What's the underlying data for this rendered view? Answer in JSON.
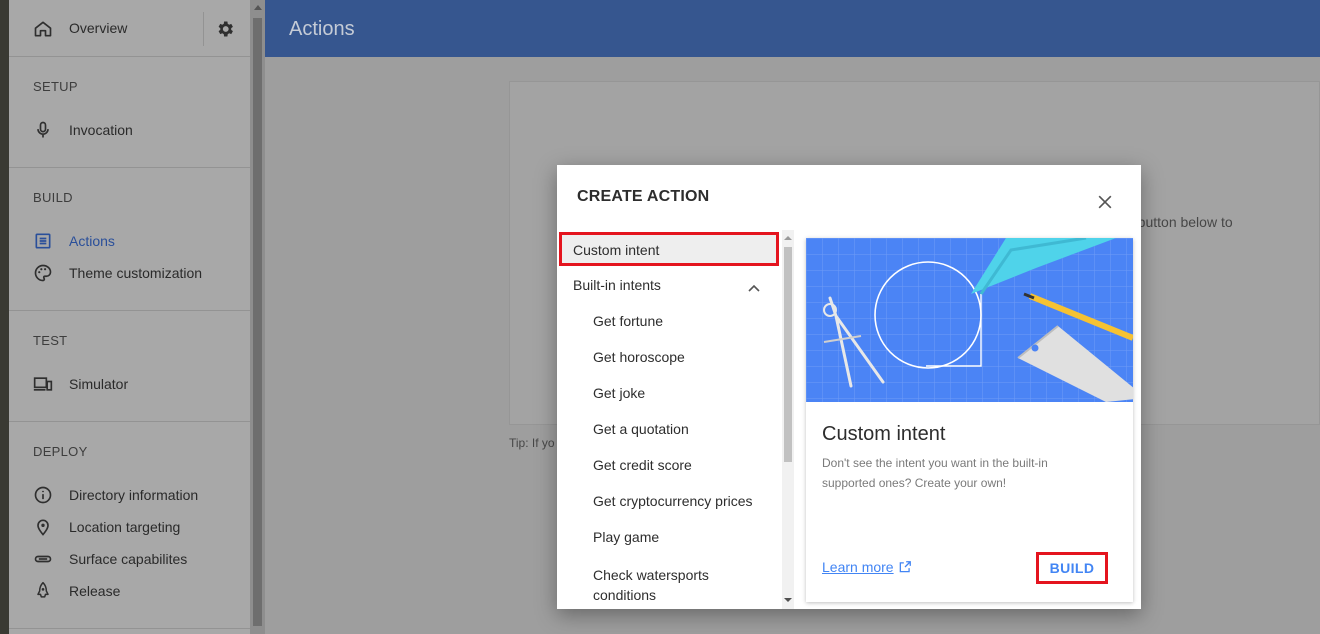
{
  "sidebar": {
    "overview_label": "Overview",
    "sections": [
      {
        "heading": "SETUP",
        "items": [
          {
            "label": "Invocation",
            "icon": "microphone-icon"
          }
        ]
      },
      {
        "heading": "BUILD",
        "items": [
          {
            "label": "Actions",
            "icon": "list-icon",
            "active": true
          },
          {
            "label": "Theme customization",
            "icon": "palette-icon"
          }
        ]
      },
      {
        "heading": "TEST",
        "items": [
          {
            "label": "Simulator",
            "icon": "devices-icon"
          }
        ]
      },
      {
        "heading": "DEPLOY",
        "items": [
          {
            "label": "Directory information",
            "icon": "info-icon"
          },
          {
            "label": "Location targeting",
            "icon": "location-pin-icon"
          },
          {
            "label": "Surface capabilites",
            "icon": "surface-icon"
          },
          {
            "label": "Release",
            "icon": "rocket-icon"
          }
        ]
      }
    ]
  },
  "header": {
    "title": "Actions"
  },
  "background": {
    "partial_text": "e button below to",
    "tip_partial": "Tip: If yo"
  },
  "dialog": {
    "title": "CREATE ACTION",
    "list": {
      "custom_intent": "Custom intent",
      "builtin_heading": "Built-in intents",
      "builtin_items": [
        "Get fortune",
        "Get horoscope",
        "Get joke",
        "Get a quotation",
        "Get credit score",
        "Get cryptocurrency prices",
        "Play game"
      ],
      "last_item_line1": "Check watersports",
      "last_item_line2": "conditions"
    },
    "detail": {
      "name": "Custom intent",
      "description": "Don't see the intent you want in the built-in supported ones? Create your own!",
      "learn_more": "Learn more",
      "build_button": "BUILD"
    }
  },
  "colors": {
    "header": "#36568f",
    "accent": "#4285f4",
    "highlight_box": "#e4141e",
    "illustration_bg": "#4b84f5"
  }
}
